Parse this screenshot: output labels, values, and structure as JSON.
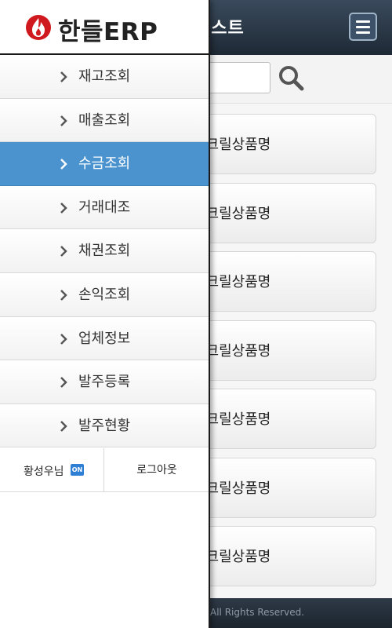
{
  "app": {
    "logo_text": "한들ERP",
    "page_title_visible": "리스트",
    "copyright_visible": "All Rights Reserved."
  },
  "search": {
    "value": "",
    "placeholder": ""
  },
  "products": [
    {
      "name": "아크릴상품명"
    },
    {
      "name": "아크릴상품명"
    },
    {
      "name": "아크릴상품명"
    },
    {
      "name": "아크릴상품명"
    },
    {
      "name": "아크릴상품명"
    },
    {
      "name": "아크릴상품명"
    },
    {
      "name": "아크릴상품명"
    }
  ],
  "drawer": {
    "menu": [
      {
        "label": "재고조회",
        "active": false
      },
      {
        "label": "매출조회",
        "active": false
      },
      {
        "label": "수금조회",
        "active": true
      },
      {
        "label": "거래대조",
        "active": false
      },
      {
        "label": "채권조회",
        "active": false
      },
      {
        "label": "손익조회",
        "active": false
      },
      {
        "label": "업체정보",
        "active": false
      },
      {
        "label": "발주등록",
        "active": false
      },
      {
        "label": "발주현황",
        "active": false
      }
    ],
    "user_name": "황성우님",
    "status_badge": "ON",
    "logout_label": "로그아웃"
  },
  "icons": {
    "logo": "flame-logo-icon",
    "menu": "hamburger-menu-icon",
    "search": "search-icon",
    "chevron": "chevron-right-icon"
  },
  "colors": {
    "active_item": "#4a93cf",
    "logo_red": "#d0191f",
    "header_dark": "#1e2935",
    "badge_blue": "#2f7fd4"
  }
}
